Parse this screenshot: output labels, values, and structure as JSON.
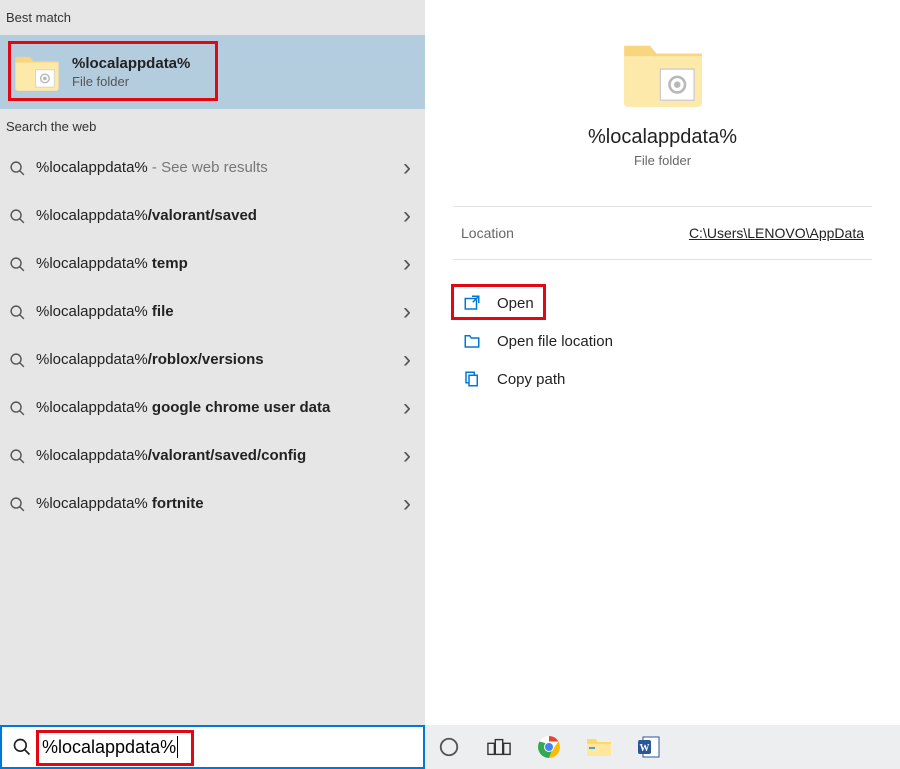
{
  "sections": {
    "best_match_header": "Best match",
    "web_header": "Search the web"
  },
  "best_match": {
    "title": "%localappdata%",
    "subtitle": "File folder"
  },
  "web_results": [
    {
      "prefix": "%localappdata%",
      "suffix": "",
      "trail": " - See web results",
      "bold_suffix": false
    },
    {
      "prefix": "%localappdata%",
      "suffix": "/valorant/saved",
      "trail": "",
      "bold_suffix": true
    },
    {
      "prefix": "%localappdata%",
      "suffix": " temp",
      "trail": "",
      "bold_suffix": true
    },
    {
      "prefix": "%localappdata%",
      "suffix": " file",
      "trail": "",
      "bold_suffix": true
    },
    {
      "prefix": "%localappdata%",
      "suffix": "/roblox/versions",
      "trail": "",
      "bold_suffix": true
    },
    {
      "prefix": "%localappdata%",
      "suffix": " google chrome user data",
      "trail": "",
      "bold_suffix": true
    },
    {
      "prefix": "%localappdata%",
      "suffix": "/valorant/saved/config",
      "trail": "",
      "bold_suffix": true
    },
    {
      "prefix": "%localappdata%",
      "suffix": " fortnite",
      "trail": "",
      "bold_suffix": true
    }
  ],
  "search_query": "%localappdata%",
  "preview": {
    "title": "%localappdata%",
    "subtitle": "File folder",
    "location_label": "Location",
    "location_value": "C:\\Users\\LENOVO\\AppData"
  },
  "actions": {
    "open": "Open",
    "open_location": "Open file location",
    "copy_path": "Copy path"
  },
  "taskbar_icons": [
    "cortana",
    "task-view",
    "chrome",
    "file-explorer",
    "word"
  ]
}
